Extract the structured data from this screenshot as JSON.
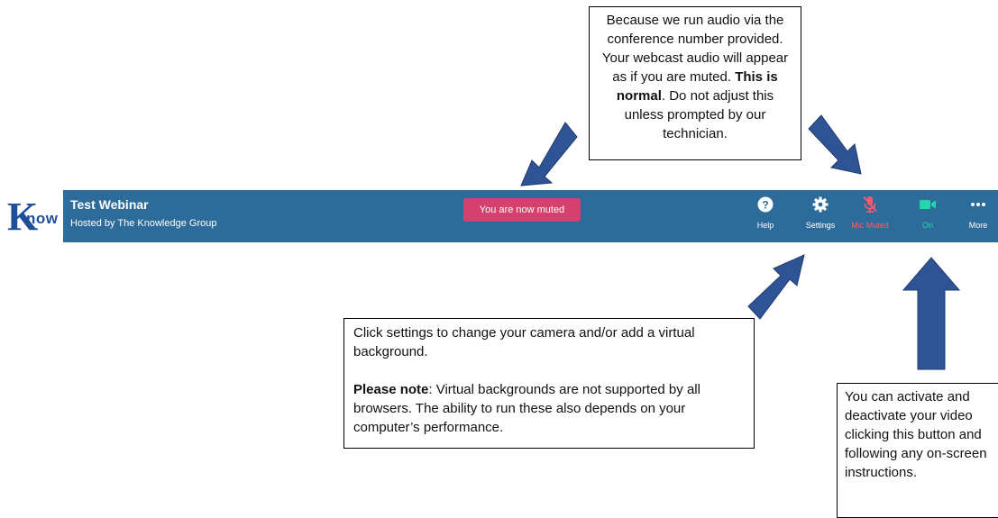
{
  "callouts": {
    "top": {
      "pre": "Because we run audio via the conference number provided. Your webcast audio will appear as if you are muted. ",
      "bold": "This is normal",
      "post": ". Do not adjust this unless prompted by our technician."
    },
    "middle": {
      "line1": "Click settings to change your camera and/or add a virtual background.",
      "bold": "Please note",
      "line2": ": Virtual backgrounds are not supported by all browsers. The ability to run these also depends on your computer’s performance."
    },
    "right": "You can activate and deactivate your video clicking this button and following any on-screen instructions."
  },
  "logo": {
    "first": "K",
    "rest": "now"
  },
  "meeting": {
    "title": "Test Webinar",
    "host": "Hosted by The Knowledge Group",
    "toast": "You are now muted"
  },
  "controls": {
    "help": "Help",
    "settings": "Settings",
    "mic": "Mic Muted",
    "video": "On",
    "more": "More"
  },
  "colors": {
    "bar": "#2d6b9a",
    "arrow": "#2f5496",
    "toast": "#d6406e",
    "mic_muted": "#ff5a6e",
    "video_on": "#27d6a8"
  },
  "icons": {
    "help": "question-circle-icon",
    "settings": "gear-icon",
    "mic": "mic-muted-icon",
    "video": "video-camera-icon",
    "more": "more-dots-icon"
  }
}
